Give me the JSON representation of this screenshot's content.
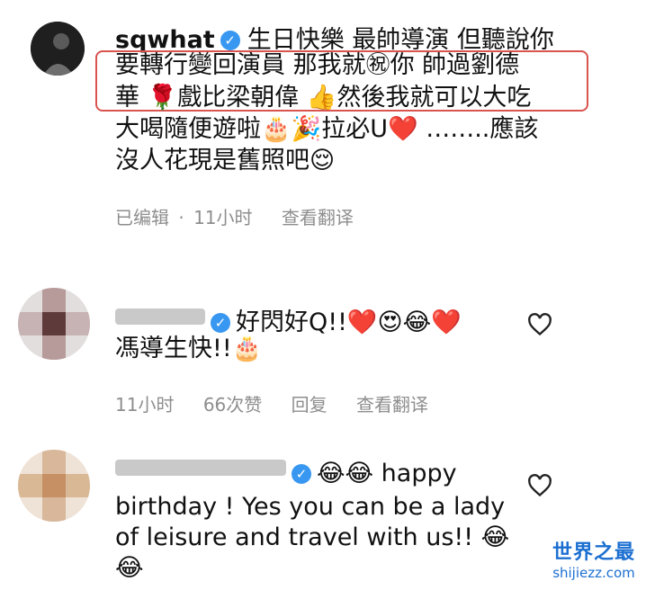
{
  "comments": [
    {
      "username": "sqwhat",
      "verified": true,
      "lines": [
        "生日快樂 最帥導演 但聽說你",
        "要轉行變回演員 那我就㊗你 帥過劉德",
        "華 🌹戲比梁朝偉 👍然後我就可以大吃",
        "大喝隨便遊啦🎂🎉拉必U❤️ ……..應該",
        "沒人花現是舊照吧😌"
      ],
      "meta": [
        "已编辑",
        "·",
        "11小时",
        "查看翻译"
      ]
    },
    {
      "username": "",
      "verified": true,
      "lines": [
        "好閃好Q!!❤️😍😂❤️",
        "馮導生快!!🎂"
      ],
      "meta": [
        "11小时",
        "66次赞",
        "回复",
        "查看翻译"
      ]
    },
    {
      "username": "",
      "verified": true,
      "lines": [
        "😂😂 happy",
        "birthday ! Yes you can be a lady",
        "of leisure and travel with us!! 😂",
        "😂"
      ]
    }
  ],
  "watermark": {
    "top": "世界之最",
    "bottom": "shijiezz.com"
  },
  "colors": {
    "accent": "#3897f0",
    "highlight": "#d9534f",
    "meta": "#8e8e8e"
  },
  "icons": {
    "verified": "verified-badge-icon",
    "like": "heart-outline-icon"
  }
}
